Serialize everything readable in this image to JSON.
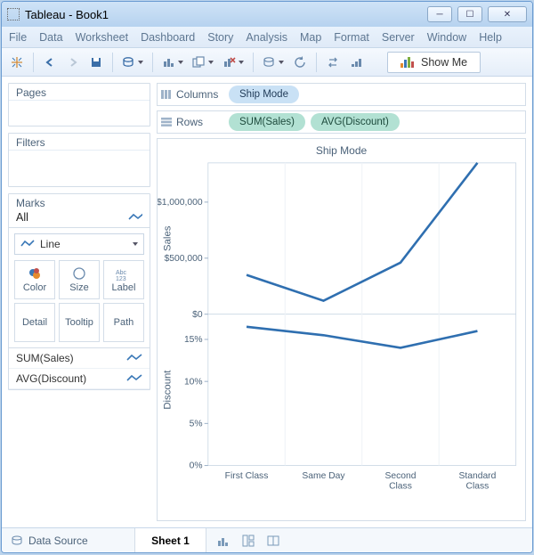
{
  "window": {
    "title": "Tableau - Book1"
  },
  "menu": {
    "items": [
      "File",
      "Data",
      "Worksheet",
      "Dashboard",
      "Story",
      "Analysis",
      "Map",
      "Format",
      "Server",
      "Window",
      "Help"
    ]
  },
  "showme": {
    "label": "Show Me"
  },
  "panels": {
    "pages": "Pages",
    "filters": "Filters",
    "marks": "Marks",
    "all": "All",
    "marktype": "Line",
    "btn_color": "Color",
    "btn_size": "Size",
    "btn_label": "Label",
    "btn_detail": "Detail",
    "btn_tooltip": "Tooltip",
    "btn_path": "Path",
    "m1": "SUM(Sales)",
    "m2": "AVG(Discount)"
  },
  "shelves": {
    "columns_label": "Columns",
    "rows_label": "Rows",
    "col_pill": "Ship Mode",
    "row_pill1": "SUM(Sales)",
    "row_pill2": "AVG(Discount)"
  },
  "viz": {
    "title": "Ship Mode",
    "y1label": "Sales",
    "y2label": "Discount",
    "y1ticks": [
      "$0",
      "$500,000",
      "$1,000,000"
    ],
    "y2ticks": [
      "0%",
      "5%",
      "10%",
      "15%"
    ],
    "xcats": [
      "First Class",
      "Same Day",
      "Second\nClass",
      "Standard\nClass"
    ]
  },
  "status": {
    "datasource": "Data Source",
    "sheet": "Sheet 1"
  },
  "chart_data": [
    {
      "type": "line",
      "title": "Ship Mode",
      "xlabel": "Ship Mode",
      "ylabel": "Sales",
      "ylim": [
        0,
        1350000
      ],
      "categories": [
        "First Class",
        "Same Day",
        "Second Class",
        "Standard Class"
      ],
      "series": [
        {
          "name": "SUM(Sales)",
          "values": [
            350000,
            120000,
            460000,
            1350000
          ]
        }
      ]
    },
    {
      "type": "line",
      "xlabel": "Ship Mode",
      "ylabel": "Discount",
      "ylim": [
        0,
        0.18
      ],
      "categories": [
        "First Class",
        "Same Day",
        "Second Class",
        "Standard Class"
      ],
      "series": [
        {
          "name": "AVG(Discount)",
          "values": [
            0.165,
            0.155,
            0.14,
            0.16
          ]
        }
      ]
    }
  ]
}
